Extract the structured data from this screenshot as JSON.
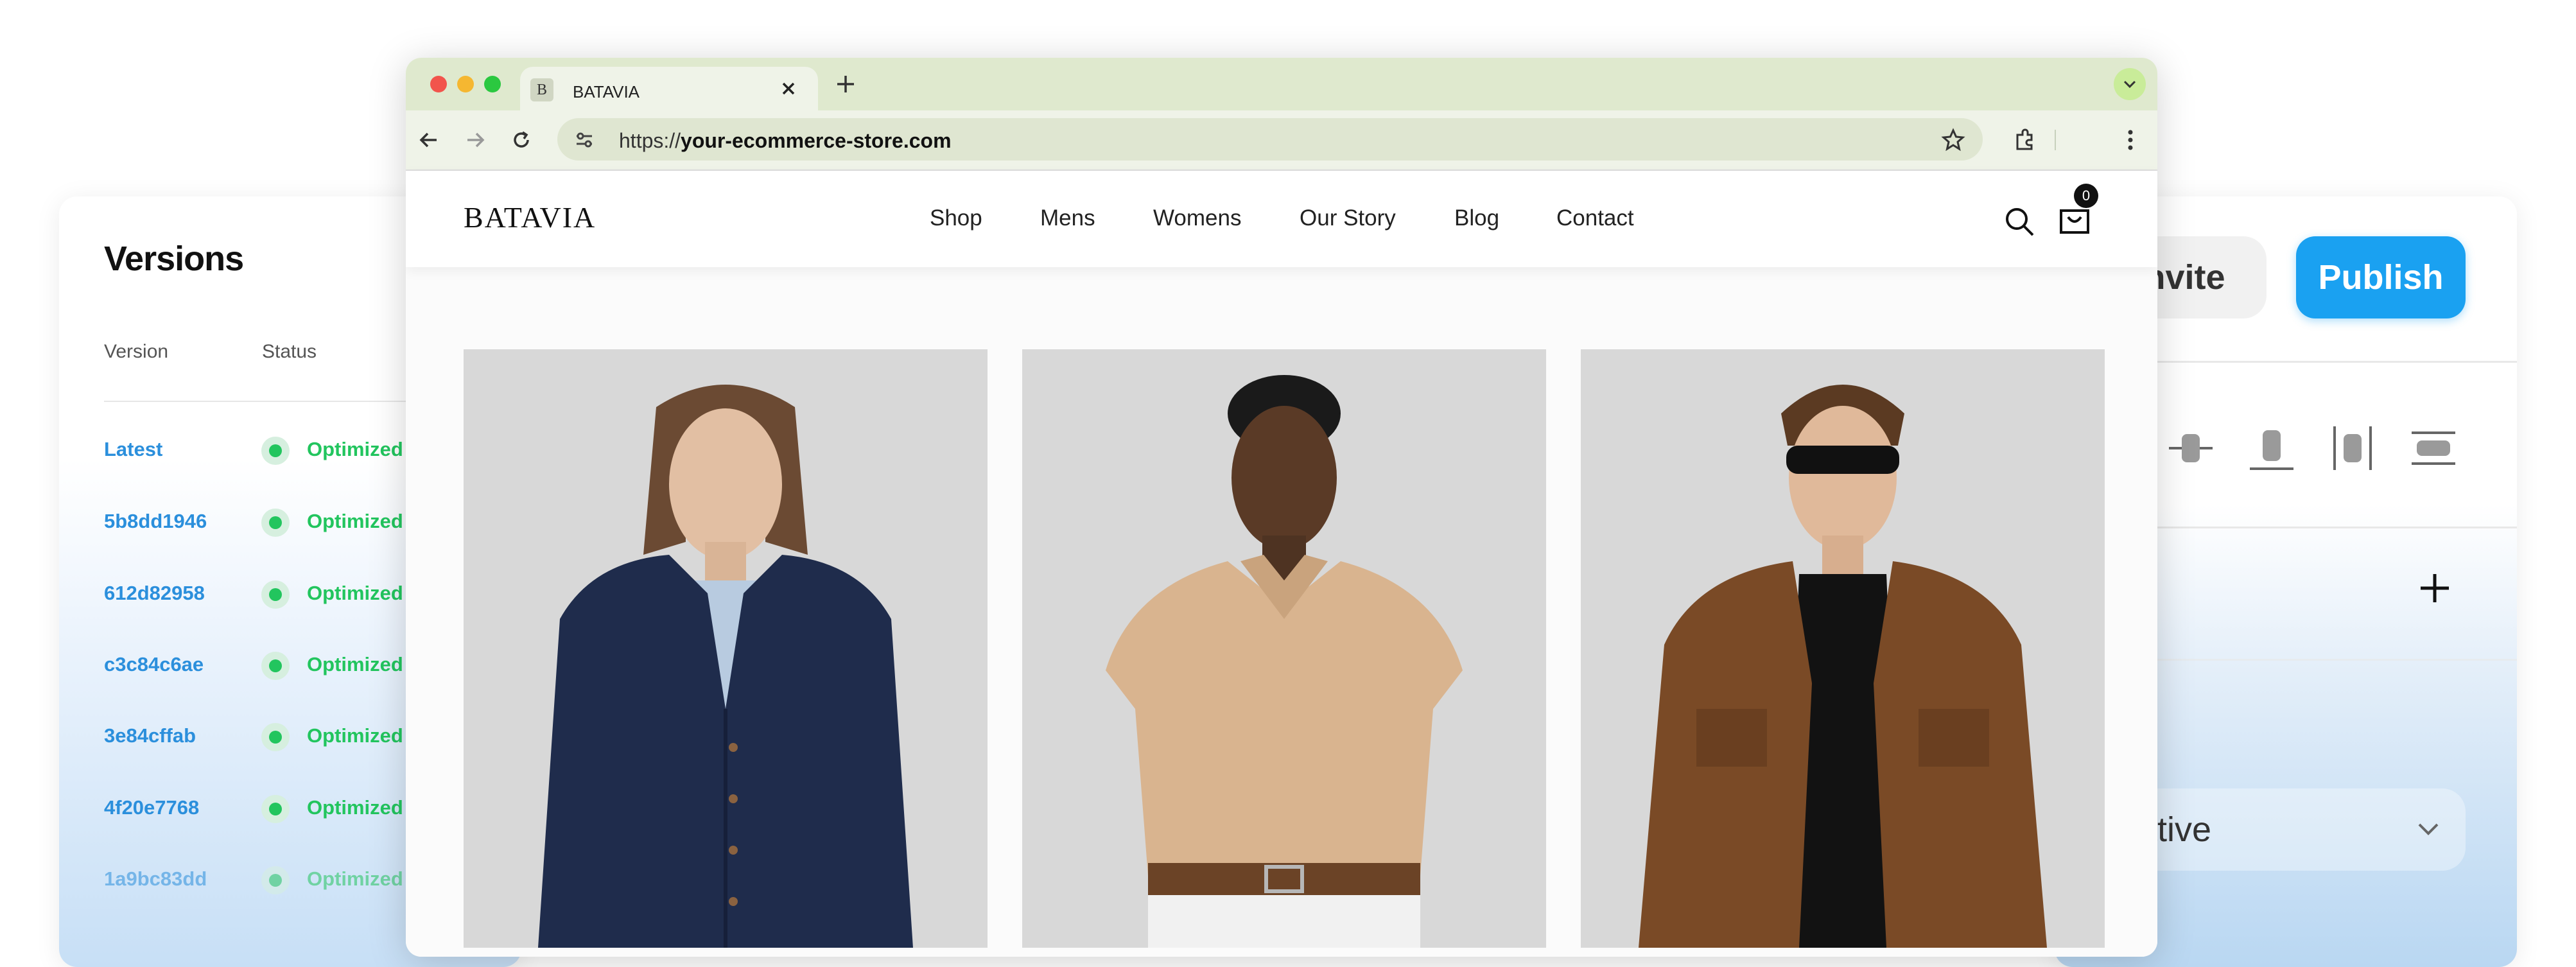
{
  "versions": {
    "title": "Versions",
    "col_version": "Version",
    "col_status": "Status",
    "rows": [
      {
        "id": "Latest",
        "status": "Optimized"
      },
      {
        "id": "5b8dd1946",
        "status": "Optimized"
      },
      {
        "id": "612d82958",
        "status": "Optimized"
      },
      {
        "id": "c3c84c6ae",
        "status": "Optimized"
      },
      {
        "id": "3e84cffab",
        "status": "Optimized"
      },
      {
        "id": "4f20e7768",
        "status": "Optimized"
      },
      {
        "id": "1a9bc83dd",
        "status": "Optimized"
      }
    ]
  },
  "editor": {
    "invite_label": "Invite",
    "publish_label": "Publish",
    "position_value": "lative"
  },
  "browser": {
    "tab_favicon": "B",
    "tab_title": "BATAVIA",
    "url_prefix": "https://",
    "url_host": "your-ecommerce-store.com"
  },
  "site": {
    "logo": "BATAVIA",
    "nav": {
      "shop": "Shop",
      "mens": "Mens",
      "womens": "Womens",
      "our_story": "Our Story",
      "blog": "Blog",
      "contact": "Contact"
    },
    "cart_count": "0"
  },
  "icons": [
    "close-icon",
    "plus-icon",
    "chevron-down-icon",
    "back-arrow-icon",
    "forward-arrow-icon",
    "reload-icon",
    "site-settings-icon",
    "star-icon",
    "extensions-icon",
    "more-vertical-icon",
    "search-icon",
    "cart-icon",
    "align-center-icon",
    "align-bottom-icon",
    "distribute-icon",
    "align-middle-icon"
  ],
  "colors": {
    "accent": "#1aa1f1",
    "link": "#2b8fdc",
    "optimized": "#22c55e",
    "tab_strip": "#dfe9ce"
  }
}
